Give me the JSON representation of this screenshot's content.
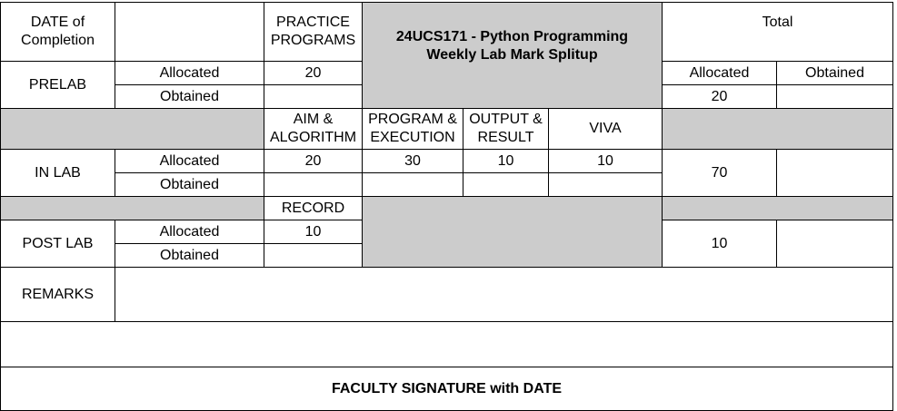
{
  "header": {
    "date_of_completion": "DATE of Completion",
    "practice_programs": "PRACTICE PROGRAMS",
    "course_title_line1": "24UCS171 - Python Programming",
    "course_title_line2": "Weekly Lab Mark Splitup",
    "total": "Total"
  },
  "prelab": {
    "label": "PRELAB",
    "allocated_label": "Allocated",
    "obtained_label": "Obtained",
    "allocated_value": "20",
    "obtained_value": "",
    "total_allocated_label": "Allocated",
    "total_obtained_label": "Obtained",
    "total_allocated_value": "20",
    "total_obtained_value": ""
  },
  "inlab_headers": {
    "aim_algorithm": "AIM & ALGORITHM",
    "program_execution": "PROGRAM & EXECUTION",
    "output_result": "OUTPUT & RESULT",
    "viva": "VIVA"
  },
  "inlab": {
    "label": "IN LAB",
    "allocated_label": "Allocated",
    "obtained_label": "Obtained",
    "allocated_values": [
      "20",
      "30",
      "10",
      "10"
    ],
    "obtained_values": [
      "",
      "",
      "",
      ""
    ],
    "total_allocated": "70",
    "total_obtained": ""
  },
  "record_header": "RECORD",
  "postlab": {
    "label": "POST LAB",
    "allocated_label": "Allocated",
    "obtained_label": "Obtained",
    "allocated_value": "10",
    "obtained_value": "",
    "total_allocated": "10",
    "total_obtained": ""
  },
  "remarks": {
    "label": "REMARKS",
    "value": ""
  },
  "faculty_signature": "FACULTY SIGNATURE with DATE",
  "colors": {
    "shaded_fill": "#cccccc",
    "grid_line": "#000000"
  }
}
